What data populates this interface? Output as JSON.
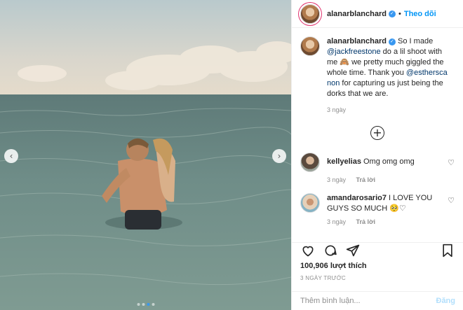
{
  "post": {
    "username": "alanarblanchard",
    "follow_label": "Theo dõi",
    "separator": "•",
    "caption_text_1": "So I made",
    "caption_mention_1": "@jackfreestone",
    "caption_text_2": "do a lil shoot with me 🙈 we pretty much giggled the whole time. Thank you",
    "caption_mention_2": "@esthersca non",
    "caption_text_3": "for capturing us just being the dorks that we are.",
    "caption_time": "3 ngày",
    "load_more_symbol": "+",
    "likes": "100,906 lượt thích",
    "date": "3 NGÀY TRƯỚC",
    "comment_placeholder": "Thêm bình luận...",
    "post_button": "Đăng"
  },
  "comments": [
    {
      "username": "kellyelias",
      "text": "Omg omg omg",
      "time": "3 ngày",
      "reply": "Trả lời"
    },
    {
      "username": "amandarosario7",
      "text": "I LOVE YOU GUYS SO MUCH 🥺♡",
      "time": "3 ngày",
      "reply": "Trả lời"
    }
  ],
  "media": {
    "prev_symbol": "‹",
    "next_symbol": "›",
    "slide_count": 4,
    "active_slide": 3
  },
  "colors": {
    "accent": "#0095f6",
    "verified": "#3897f0",
    "muted": "#8e8e8e"
  }
}
